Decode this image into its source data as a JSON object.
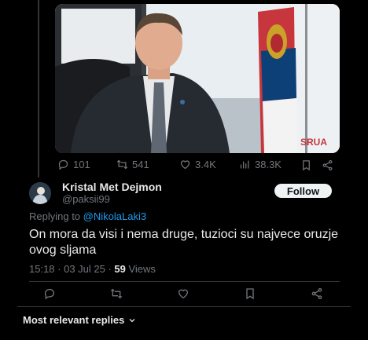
{
  "parent_tweet": {
    "stats": {
      "replies": "101",
      "reposts": "541",
      "likes": "3.4K",
      "views": "38.3K"
    }
  },
  "reply": {
    "author_name": "Kristal Met Dejmon",
    "author_handle": "@paksii99",
    "follow_label": "Follow",
    "replying_prefix": "Replying to ",
    "replying_to": "@NikolaLaki3",
    "text": "On mora da visi i nema druge, tuzioci su najvece oruzje ovog sljama",
    "time_date": "15:18 · 03 Jul 25 · ",
    "views_count": "59",
    "views_label": " Views"
  },
  "replies_filter": {
    "label": "Most relevant replies"
  },
  "icons": {
    "reply": "reply-icon",
    "repost": "repost-icon",
    "like": "heart-icon",
    "views": "views-icon",
    "bookmark": "bookmark-icon",
    "share": "share-icon",
    "chevron": "chevron-down-icon"
  },
  "colors": {
    "background": "#000000",
    "text": "#e7e9ea",
    "muted": "#71767b",
    "link": "#1d9bf0",
    "follow_bg": "#eff3f4"
  }
}
